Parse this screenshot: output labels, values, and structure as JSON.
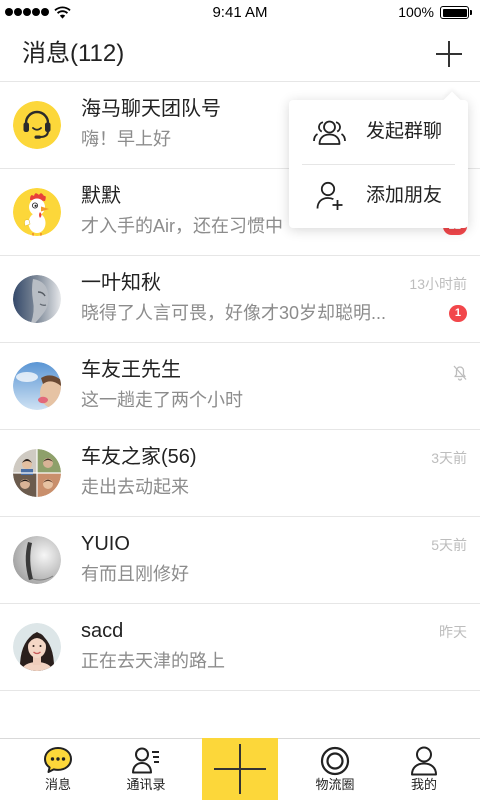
{
  "status_bar": {
    "signal": {
      "filled": 5,
      "total": 5,
      "icon": "signal-dots-icon"
    },
    "wifi_icon": "wifi-icon",
    "time": "9:41 AM",
    "battery": {
      "label": "100%",
      "level": 1.0,
      "icon": "battery-icon"
    }
  },
  "header": {
    "title": "消息(112)",
    "add_icon": "plus-icon"
  },
  "popup_menu": {
    "items": [
      {
        "label": "发起群聊",
        "icon": "group-chat-icon"
      },
      {
        "label": "添加朋友",
        "icon": "add-friend-icon"
      }
    ]
  },
  "conversations": [
    {
      "name": "海马聊天团队号",
      "preview": "嗨！早上好",
      "avatar": "headset-avatar"
    },
    {
      "name": "默默",
      "preview": "才入手的Air，还在习惯中",
      "badge": "22",
      "avatar": "cartoon-rooster-avatar"
    },
    {
      "name": "一叶知秋",
      "preview": "晓得了人言可畏，好像才30岁却聪明...",
      "time": "13小时前",
      "badge": "1",
      "avatar": "photo-avatar"
    },
    {
      "name": "车友王先生",
      "preview": "这一趟走了两个小时",
      "muted": true,
      "mute_icon": "bell-muted-icon",
      "avatar": "photo-avatar"
    },
    {
      "name": "车友之家(56)",
      "preview": "走出去动起来",
      "time": "3天前",
      "avatar": "group-collage-avatar"
    },
    {
      "name": "YUIO",
      "preview": "有而且刚修好",
      "time": "5天前",
      "avatar": "photo-avatar"
    },
    {
      "name": "sacd",
      "preview": "正在去天津的路上",
      "time": "昨天",
      "avatar": "photo-avatar"
    }
  ],
  "tab_bar": {
    "items": [
      {
        "label": "消息",
        "icon": "chat-bubble-icon",
        "active": true
      },
      {
        "label": "通讯录",
        "icon": "contacts-icon"
      },
      {
        "icon": "plus-icon"
      },
      {
        "label": "物流圈",
        "icon": "logistics-circle-icon"
      },
      {
        "label": "我的",
        "icon": "person-icon"
      }
    ]
  },
  "colors": {
    "accent": "#fcd73a",
    "badge": "#f2474b",
    "text_primary": "#222222",
    "text_secondary": "#8c8c8c",
    "text_time": "#bdbdbd",
    "divider": "#e6e6e6"
  }
}
